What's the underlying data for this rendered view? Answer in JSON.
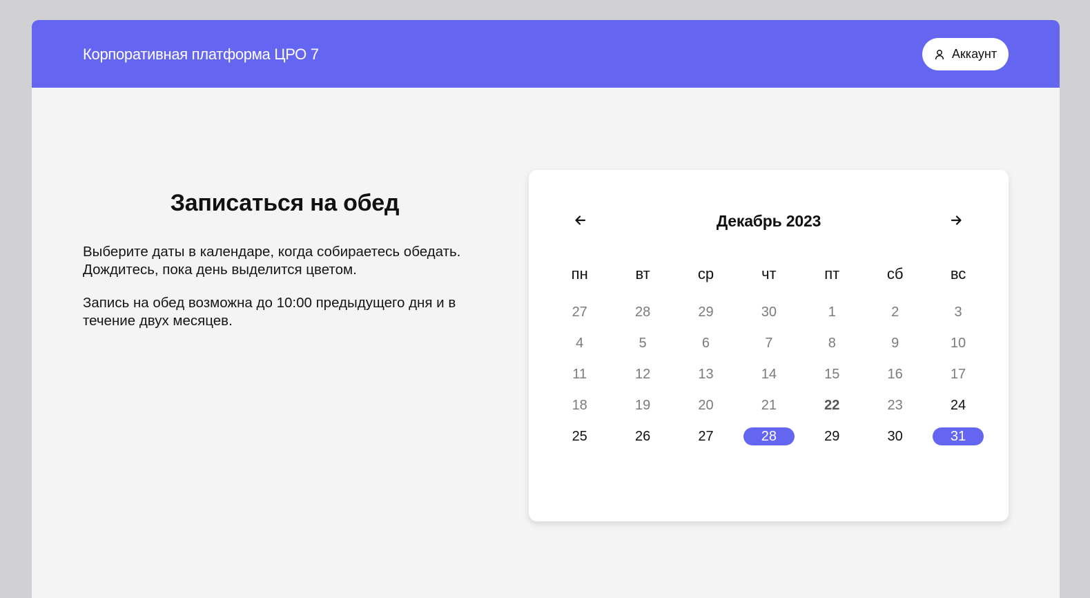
{
  "header": {
    "brand": "Корпоративная платформа ЦРО 7",
    "account_label": "Аккаунт",
    "account_icon": "user-icon",
    "accent_color": "#6466f1"
  },
  "main": {
    "title": "Записаться на обед",
    "paragraph1": "Выберите даты в календаре, когда собираетесь обедать. Дождитесь, пока день выделится цветом.",
    "paragraph2": "Запись на обед возможна до 10:00 предыдущего дня и в течение двух месяцев."
  },
  "calendar": {
    "month_label": "Декабрь 2023",
    "prev_icon": "arrow-left-icon",
    "next_icon": "arrow-right-icon",
    "weekdays": [
      "пн",
      "вт",
      "ср",
      "чт",
      "пт",
      "сб",
      "вс"
    ],
    "days": [
      {
        "label": "27",
        "state": "disabled"
      },
      {
        "label": "28",
        "state": "disabled"
      },
      {
        "label": "29",
        "state": "disabled"
      },
      {
        "label": "30",
        "state": "disabled"
      },
      {
        "label": "1",
        "state": "disabled"
      },
      {
        "label": "2",
        "state": "disabled"
      },
      {
        "label": "3",
        "state": "disabled"
      },
      {
        "label": "4",
        "state": "disabled"
      },
      {
        "label": "5",
        "state": "disabled"
      },
      {
        "label": "6",
        "state": "disabled"
      },
      {
        "label": "7",
        "state": "disabled"
      },
      {
        "label": "8",
        "state": "disabled"
      },
      {
        "label": "9",
        "state": "disabled"
      },
      {
        "label": "10",
        "state": "disabled"
      },
      {
        "label": "11",
        "state": "disabled"
      },
      {
        "label": "12",
        "state": "disabled"
      },
      {
        "label": "13",
        "state": "disabled"
      },
      {
        "label": "14",
        "state": "disabled"
      },
      {
        "label": "15",
        "state": "disabled"
      },
      {
        "label": "16",
        "state": "disabled"
      },
      {
        "label": "17",
        "state": "disabled"
      },
      {
        "label": "18",
        "state": "disabled"
      },
      {
        "label": "19",
        "state": "disabled"
      },
      {
        "label": "20",
        "state": "disabled"
      },
      {
        "label": "21",
        "state": "disabled"
      },
      {
        "label": "22",
        "state": "today"
      },
      {
        "label": "23",
        "state": "disabled"
      },
      {
        "label": "24",
        "state": "available"
      },
      {
        "label": "25",
        "state": "available"
      },
      {
        "label": "26",
        "state": "available"
      },
      {
        "label": "27",
        "state": "available"
      },
      {
        "label": "28",
        "state": "selected"
      },
      {
        "label": "29",
        "state": "available"
      },
      {
        "label": "30",
        "state": "available"
      },
      {
        "label": "31",
        "state": "selected"
      }
    ]
  }
}
